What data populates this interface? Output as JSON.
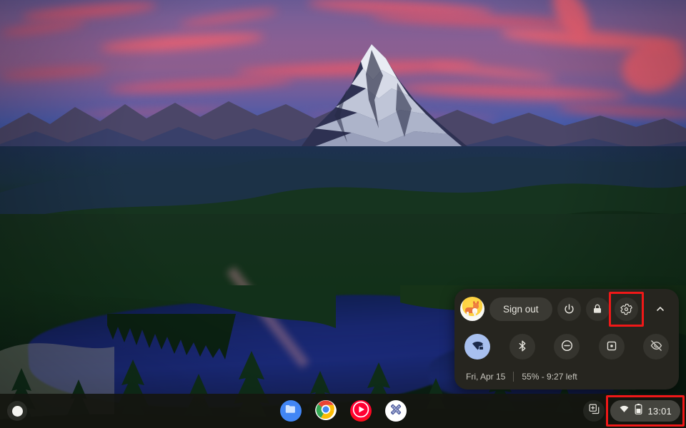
{
  "desktop": {
    "wallpaper_description": "mountain-sunset-lake",
    "wallpaper_colors": {
      "sky_top": "#6a5a94",
      "sky_pink": "#ef5f6e",
      "sky_blue": "#25407e",
      "forest": "#123019",
      "lake": "#1b2b7d",
      "snow": "#e8eaf2"
    }
  },
  "quick_settings": {
    "avatar_name": "avatar",
    "sign_out_label": "Sign out",
    "buttons": [
      {
        "name": "power-button",
        "icon": "power-icon"
      },
      {
        "name": "lock-button",
        "icon": "lock-icon"
      },
      {
        "name": "settings-button",
        "icon": "gear-icon",
        "highlighted": true
      },
      {
        "name": "collapse-button",
        "icon": "chevron-up-icon"
      }
    ],
    "toggles": [
      {
        "name": "wifi-toggle",
        "icon": "wifi-locked-icon",
        "active": true
      },
      {
        "name": "bluetooth-toggle",
        "icon": "bluetooth-icon",
        "active": false
      },
      {
        "name": "do-not-disturb-toggle",
        "icon": "do-not-disturb-icon",
        "active": false
      },
      {
        "name": "screen-capture-toggle",
        "icon": "screen-capture-icon",
        "active": false
      },
      {
        "name": "night-light-toggle",
        "icon": "eye-off-icon",
        "active": false
      }
    ],
    "date": "Fri, Apr 15",
    "battery_status": "55% - 9:27 left",
    "highlight_color": "#f01818"
  },
  "shelf": {
    "launcher_name": "launcher-button",
    "apps": [
      {
        "name": "files-app",
        "label": "Files",
        "color": "#4286f5"
      },
      {
        "name": "chrome-app",
        "label": "Chrome",
        "color": "#ffffff"
      },
      {
        "name": "youtube-music-app",
        "label": "YouTube Music",
        "color": "#fc0d1b"
      },
      {
        "name": "canvas-app",
        "label": "Canvas",
        "color": "#ffffff"
      }
    ],
    "desk_button_label": "new-desk",
    "status_time": "13:01",
    "status_icons": [
      "wifi-icon",
      "battery-icon"
    ],
    "status_highlighted": true
  }
}
